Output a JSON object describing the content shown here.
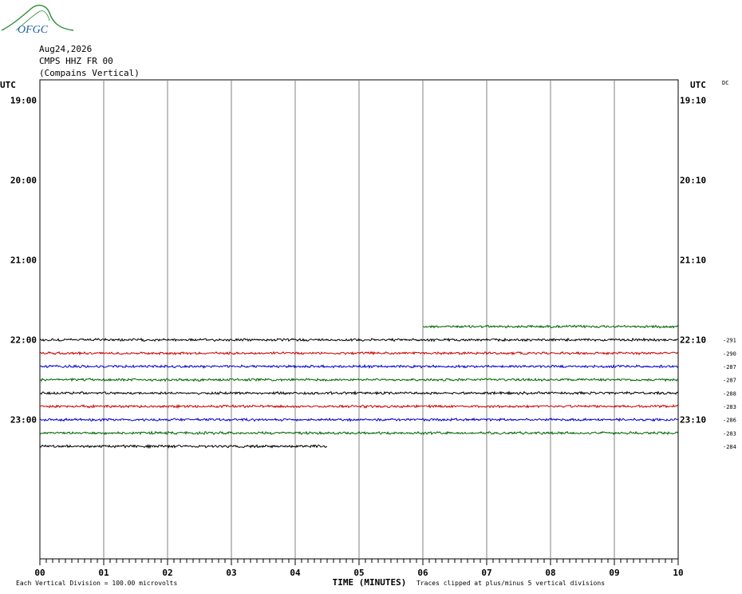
{
  "logo": {
    "text": "OFGC",
    "arc_color": "#2e8b3a",
    "text_color": "#1f5fa8"
  },
  "header": {
    "date": "Aug24,2026",
    "station": "CMPS HHZ FR 00",
    "location": "(Compains Vertical)"
  },
  "chart_data": {
    "type": "line",
    "title": "",
    "left_label": "UTC",
    "right_label": "UTC",
    "dc_label": "DC",
    "xlabel": "TIME (MINUTES)",
    "x_ticks": [
      "00",
      "01",
      "02",
      "03",
      "04",
      "05",
      "06",
      "07",
      "08",
      "09",
      "10"
    ],
    "xlim": [
      0,
      10
    ],
    "left_hour_labels": [
      {
        "row": 1,
        "text": "19:00"
      },
      {
        "row": 7,
        "text": "20:00"
      },
      {
        "row": 13,
        "text": "21:00"
      },
      {
        "row": 19,
        "text": "22:00"
      },
      {
        "row": 25,
        "text": "23:00"
      }
    ],
    "right_hour_labels": [
      {
        "row": 1,
        "text": "19:10"
      },
      {
        "row": 7,
        "text": "20:10"
      },
      {
        "row": 13,
        "text": "21:10"
      },
      {
        "row": 19,
        "text": "22:10"
      },
      {
        "row": 25,
        "text": "23:10"
      }
    ],
    "row_count": 36,
    "traces": [
      {
        "row": 18,
        "x_start": 6.0,
        "x_end": 10.0,
        "color": "#006400",
        "dc": ""
      },
      {
        "row": 19,
        "x_start": 0.0,
        "x_end": 10.0,
        "color": "#000000",
        "dc": "-291"
      },
      {
        "row": 20,
        "x_start": 0.0,
        "x_end": 10.0,
        "color": "#cc0000",
        "dc": "-290"
      },
      {
        "row": 21,
        "x_start": 0.0,
        "x_end": 10.0,
        "color": "#0000cc",
        "dc": "-287"
      },
      {
        "row": 22,
        "x_start": 0.0,
        "x_end": 10.0,
        "color": "#006400",
        "dc": "-287"
      },
      {
        "row": 23,
        "x_start": 0.0,
        "x_end": 10.0,
        "color": "#000000",
        "dc": "-288"
      },
      {
        "row": 24,
        "x_start": 0.0,
        "x_end": 10.0,
        "color": "#cc0000",
        "dc": "-283"
      },
      {
        "row": 25,
        "x_start": 0.0,
        "x_end": 10.0,
        "color": "#0000cc",
        "dc": "-286"
      },
      {
        "row": 26,
        "x_start": 0.0,
        "x_end": 10.0,
        "color": "#006400",
        "dc": "-283"
      },
      {
        "row": 27,
        "x_start": 0.0,
        "x_end": 4.5,
        "color": "#000000",
        "dc": "-284"
      }
    ],
    "footer_left": "Each Vertical Division =  100.00 microvolts",
    "footer_right": "Traces clipped at plus/minus 5 vertical divisions",
    "grid": true
  }
}
